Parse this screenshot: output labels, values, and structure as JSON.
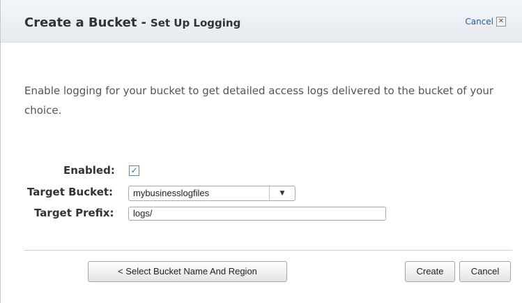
{
  "header": {
    "title": "Create a Bucket",
    "separator": "-",
    "subtitle": "Set Up Logging",
    "cancel_label": "Cancel",
    "close_glyph": "✕"
  },
  "description": "Enable logging for your bucket to get detailed access logs delivered to the bucket of your choice.",
  "form": {
    "enabled_label": "Enabled:",
    "enabled_checked": true,
    "checkmark_glyph": "✓",
    "target_bucket_label": "Target Bucket:",
    "target_bucket_value": "mybusinesslogfiles",
    "dropdown_arrow_glyph": "▼",
    "target_prefix_label": "Target Prefix:",
    "target_prefix_value": "logs/"
  },
  "footer": {
    "back_label": "< Select Bucket Name And Region",
    "create_label": "Create",
    "cancel_label": "Cancel"
  },
  "icons": {
    "close": "close-icon",
    "checkbox": "checkbox-icon",
    "dropdown": "chevron-down-icon"
  },
  "colors": {
    "header_bg": "#e6ebf0",
    "link": "#1f5aa8",
    "check": "#2b6fd6"
  }
}
